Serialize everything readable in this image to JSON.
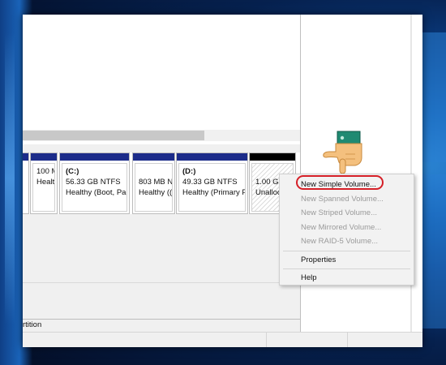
{
  "partitions": [
    {
      "name": "",
      "line1": "",
      "line2": ""
    },
    {
      "name": "",
      "line1": "100 M",
      "line2": "Health"
    },
    {
      "name": "(C:)",
      "line1": "56.33 GB NTFS",
      "line2": "Healthy (Boot, Pag"
    },
    {
      "name": "",
      "line1": "803 MB N",
      "line2": "Healthy (("
    },
    {
      "name": "(D:)",
      "line1": "49.33 GB NTFS",
      "line2": "Healthy (Primary P"
    },
    {
      "name": "",
      "line1": "1.00 GB",
      "line2": "Unalloc"
    }
  ],
  "legend": {
    "text": "rtition"
  },
  "context_menu": {
    "items": [
      {
        "label": "New Simple Volume...",
        "enabled": true
      },
      {
        "label": "New Spanned Volume...",
        "enabled": false
      },
      {
        "label": "New Striped Volume...",
        "enabled": false
      },
      {
        "label": "New Mirrored Volume...",
        "enabled": false
      },
      {
        "label": "New RAID-5 Volume...",
        "enabled": false
      },
      {
        "label": "Properties",
        "enabled": true
      },
      {
        "label": "Help",
        "enabled": true
      }
    ]
  },
  "colors": {
    "partition_bar": "#1c2c8a",
    "unallocated_bar": "#000000",
    "highlight": "#d51f27",
    "desktop": "#0b3f86"
  },
  "icons": {
    "pointer": "pointing-hand-icon"
  }
}
